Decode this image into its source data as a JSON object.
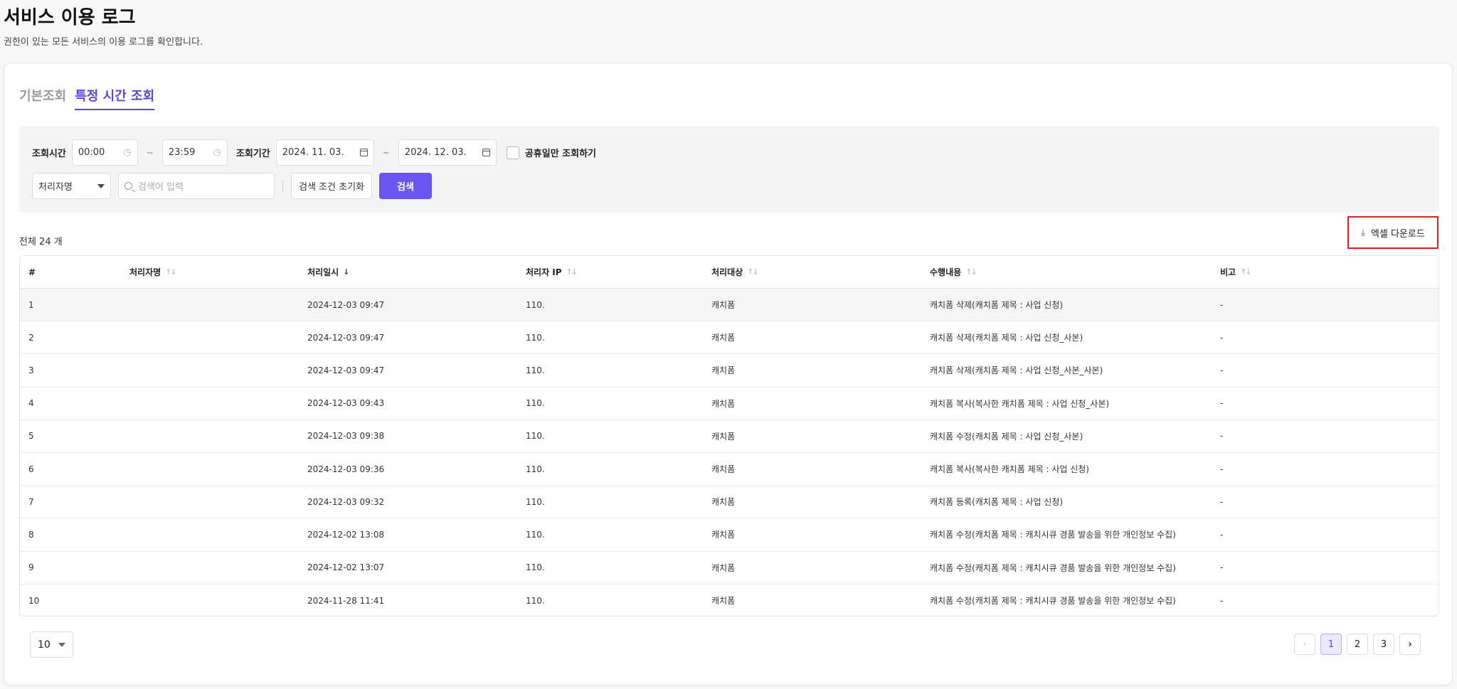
{
  "header": {
    "title": "서비스 이용 로그",
    "subtitle": "권한이 있는 모든 서비스의 이용 로그를 확인합니다."
  },
  "tabs": [
    {
      "label": "기본조회",
      "active": false
    },
    {
      "label": "특정 시간 조회",
      "active": true
    }
  ],
  "filters": {
    "time_label": "조회시간",
    "time_from": "00:00",
    "time_to": "23:59",
    "period_label": "조회기간",
    "date_from": "2024. 11. 03.",
    "date_to": "2024. 12. 03.",
    "tilde": "~",
    "holiday_only_label": "공휴일만 조회하기",
    "field_select_value": "처리자명",
    "search_placeholder": "검색어 입력",
    "reset_label": "검색 조건 초기화",
    "search_label": "검색"
  },
  "total_label": "전체 24 개",
  "excel_download_label": "엑셀 다운로드",
  "table": {
    "columns": [
      "#",
      "처리자명",
      "처리일시",
      "처리자 IP",
      "처리대상",
      "수행내용",
      "비고"
    ],
    "rows": [
      {
        "no": "1",
        "name": "",
        "datetime": "2024-12-03 09:47",
        "ip": "110.",
        "target": "캐치폼",
        "action": "캐치폼 삭제(캐치폼 제목 : 사업 신청)",
        "note": "-"
      },
      {
        "no": "2",
        "name": "",
        "datetime": "2024-12-03 09:47",
        "ip": "110.",
        "target": "캐치폼",
        "action": "캐치폼 삭제(캐치폼 제목 : 사업 신청_사본)",
        "note": "-"
      },
      {
        "no": "3",
        "name": "",
        "datetime": "2024-12-03 09:47",
        "ip": "110.",
        "target": "캐치폼",
        "action": "캐치폼 삭제(캐치폼 제목 : 사업 신청_사본_사본)",
        "note": "-"
      },
      {
        "no": "4",
        "name": "",
        "datetime": "2024-12-03 09:43",
        "ip": "110.",
        "target": "캐치폼",
        "action": "캐치폼 복사(복사한 캐치폼 제목 : 사업 신청_사본)",
        "note": "-"
      },
      {
        "no": "5",
        "name": "",
        "datetime": "2024-12-03 09:38",
        "ip": "110.",
        "target": "캐치폼",
        "action": "캐치폼 수정(캐치폼 제목 : 사업 신청_사본)",
        "note": "-"
      },
      {
        "no": "6",
        "name": "",
        "datetime": "2024-12-03 09:36",
        "ip": "110.",
        "target": "캐치폼",
        "action": "캐치폼 복사(복사한 캐치폼 제목 : 사업 신청)",
        "note": "-"
      },
      {
        "no": "7",
        "name": "",
        "datetime": "2024-12-03 09:32",
        "ip": "110.",
        "target": "캐치폼",
        "action": "캐치폼 등록(캐치폼 제목 : 사업 신청)",
        "note": "-"
      },
      {
        "no": "8",
        "name": "",
        "datetime": "2024-12-02 13:08",
        "ip": "110.",
        "target": "캐치폼",
        "action": "캐치폼 수정(캐치폼 제목 : 캐치시큐 경품 발송을 위한 개인정보 수집)",
        "note": "-"
      },
      {
        "no": "9",
        "name": "",
        "datetime": "2024-12-02 13:07",
        "ip": "110.",
        "target": "캐치폼",
        "action": "캐치폼 수정(캐치폼 제목 : 캐치시큐 경품 발송을 위한 개인정보 수집)",
        "note": "-"
      },
      {
        "no": "10",
        "name": "",
        "datetime": "2024-11-28 11:41",
        "ip": "110.",
        "target": "캐치폼",
        "action": "캐치폼 수정(캐치폼 제목 : 캐치시큐 경품 발송을 위한 개인정보 수집)",
        "note": "-"
      }
    ]
  },
  "pagination": {
    "per_page": "10",
    "pages": [
      "1",
      "2",
      "3"
    ],
    "current": "1",
    "prev_icon": "chevron-left-icon",
    "next_icon": "chevron-right-icon"
  },
  "colors": {
    "accent": "#5b45e6",
    "primary_button": "#6b55f3",
    "highlight_border": "#e02020"
  }
}
